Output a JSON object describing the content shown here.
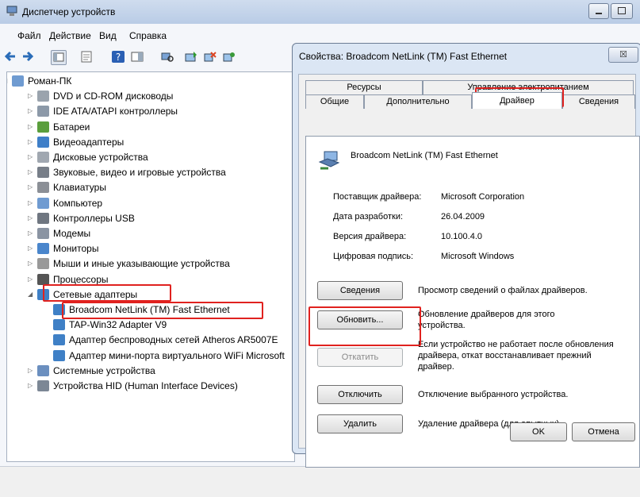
{
  "window": {
    "title": "Диспетчер устройств",
    "menu": [
      "Файл",
      "Действие",
      "Вид",
      "Справка"
    ]
  },
  "tree": [
    {
      "label": "Роман-ПК",
      "level": 0,
      "expander": "open",
      "icon": "computer-icon"
    },
    {
      "label": "DVD и CD-ROM дисководы",
      "level": 1,
      "expander": "closed",
      "icon": "dvd-drive-icon"
    },
    {
      "label": "IDE ATA/ATAPI контроллеры",
      "level": 1,
      "expander": "closed",
      "icon": "ide-controller-icon"
    },
    {
      "label": "Батареи",
      "level": 1,
      "expander": "closed",
      "icon": "battery-icon"
    },
    {
      "label": "Видеоадаптеры",
      "level": 1,
      "expander": "closed",
      "icon": "display-adapter-icon"
    },
    {
      "label": "Дисковые устройства",
      "level": 1,
      "expander": "closed",
      "icon": "disk-drive-icon"
    },
    {
      "label": "Звуковые, видео и игровые устройства",
      "level": 1,
      "expander": "closed",
      "icon": "speaker-icon"
    },
    {
      "label": "Клавиатуры",
      "level": 1,
      "expander": "closed",
      "icon": "keyboard-icon"
    },
    {
      "label": "Компьютер",
      "level": 1,
      "expander": "closed",
      "icon": "computer-icon"
    },
    {
      "label": "Контроллеры USB",
      "level": 1,
      "expander": "closed",
      "icon": "usb-icon"
    },
    {
      "label": "Модемы",
      "level": 1,
      "expander": "closed",
      "icon": "modem-icon"
    },
    {
      "label": "Мониторы",
      "level": 1,
      "expander": "closed",
      "icon": "monitor-icon"
    },
    {
      "label": "Мыши и иные указывающие устройства",
      "level": 1,
      "expander": "closed",
      "icon": "mouse-icon"
    },
    {
      "label": "Процессоры",
      "level": 1,
      "expander": "closed",
      "icon": "processor-icon"
    },
    {
      "label": "Сетевые адаптеры",
      "level": 1,
      "expander": "open",
      "icon": "network-adapter-icon"
    },
    {
      "label": "Broadcom NetLink (TM) Fast Ethernet",
      "level": 2,
      "expander": "none",
      "icon": "network-adapter-icon"
    },
    {
      "label": "TAP-Win32 Adapter V9",
      "level": 2,
      "expander": "none",
      "icon": "network-adapter-icon"
    },
    {
      "label": "Адаптер беспроводных сетей Atheros AR5007E",
      "level": 2,
      "expander": "none",
      "icon": "network-adapter-icon"
    },
    {
      "label": "Адаптер мини-порта виртуального WiFi Microsoft",
      "level": 2,
      "expander": "none",
      "icon": "network-adapter-icon"
    },
    {
      "label": "Системные устройства",
      "level": 1,
      "expander": "closed",
      "icon": "system-devices-icon"
    },
    {
      "label": "Устройства HID (Human Interface Devices)",
      "level": 1,
      "expander": "closed",
      "icon": "hid-icon"
    }
  ],
  "dialog": {
    "title": "Свойства: Broadcom NetLink (TM) Fast Ethernet",
    "close": "☒",
    "tabs_row1": [
      "Ресурсы",
      "Управление электропитанием"
    ],
    "tabs_row2": [
      "Общие",
      "Дополнительно",
      "Драйвер",
      "Сведения"
    ],
    "active_tab": "Драйвер",
    "device_name": "Broadcom NetLink (TM) Fast Ethernet",
    "info": [
      {
        "label": "Поставщик драйвера:",
        "value": "Microsoft Corporation"
      },
      {
        "label": "Дата разработки:",
        "value": "26.04.2009"
      },
      {
        "label": "Версия драйвера:",
        "value": "10.100.4.0"
      },
      {
        "label": "Цифровая подпись:",
        "value": "Microsoft Windows"
      }
    ],
    "actions": [
      {
        "button": "Сведения",
        "description": "Просмотр сведений о файлах драйверов.",
        "enabled": true
      },
      {
        "button": "Обновить...",
        "description": "Обновление драйверов для этого устройства.",
        "enabled": true
      },
      {
        "button": "Откатить",
        "description": "Если устройство не работает после обновления драйвера, откат восстанавливает прежний драйвер.",
        "enabled": false
      },
      {
        "button": "Отключить",
        "description": "Отключение выбранного устройства.",
        "enabled": true
      },
      {
        "button": "Удалить",
        "description": "Удаление драйвера (для опытных).",
        "enabled": true
      }
    ],
    "ok": "OK",
    "cancel": "Отмена"
  },
  "colors": {
    "highlight": "#e0221f",
    "titlebar": "#b9cce6"
  }
}
